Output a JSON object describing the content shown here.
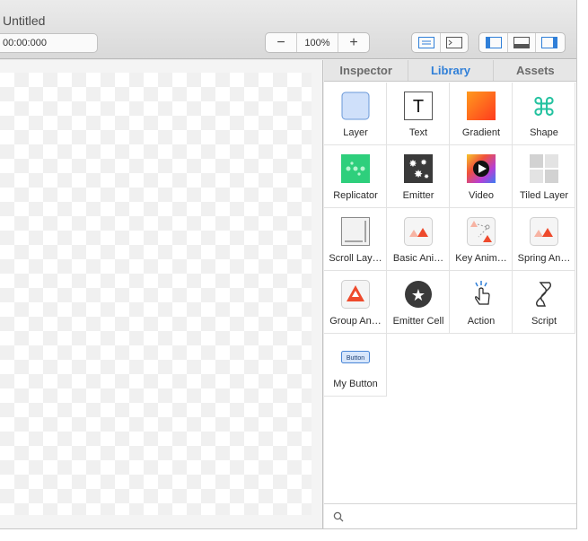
{
  "window": {
    "title": "Untitled"
  },
  "toolbar": {
    "time_value": "00:00:000",
    "zoom_out_label": "−",
    "zoom_value": "100%",
    "zoom_in_label": "+"
  },
  "panel": {
    "tabs": [
      {
        "label": "Inspector"
      },
      {
        "label": "Library"
      },
      {
        "label": "Assets"
      }
    ],
    "active_tab": "Library",
    "accent_color": "#2f7fd8",
    "library_items": [
      {
        "label": "Layer",
        "icon": "layer-icon"
      },
      {
        "label": "Text",
        "icon": "text-icon"
      },
      {
        "label": "Gradient",
        "icon": "gradient-icon"
      },
      {
        "label": "Shape",
        "icon": "shape-icon"
      },
      {
        "label": "Replicator",
        "icon": "replicator-icon"
      },
      {
        "label": "Emitter",
        "icon": "emitter-icon"
      },
      {
        "label": "Video",
        "icon": "video-icon"
      },
      {
        "label": "Tiled Layer",
        "icon": "tiled-layer-icon"
      },
      {
        "label": "Scroll Lay…",
        "icon": "scroll-layer-icon"
      },
      {
        "label": "Basic Ani…",
        "icon": "basic-animation-icon"
      },
      {
        "label": "Key Anim…",
        "icon": "key-animation-icon"
      },
      {
        "label": "Spring An…",
        "icon": "spring-animation-icon"
      },
      {
        "label": "Group An…",
        "icon": "group-animation-icon"
      },
      {
        "label": "Emitter Cell",
        "icon": "emitter-cell-icon"
      },
      {
        "label": "Action",
        "icon": "action-icon"
      },
      {
        "label": "Script",
        "icon": "script-icon"
      },
      {
        "label": "My Button",
        "icon": "my-button-icon",
        "icon_text": "Button"
      }
    ]
  }
}
